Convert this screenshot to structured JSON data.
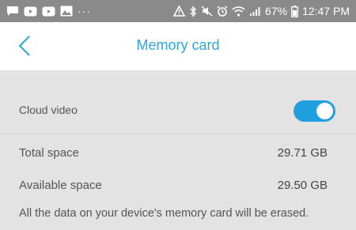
{
  "status_bar": {
    "battery": "67%",
    "time": "12:47 PM",
    "overflow": "···"
  },
  "header": {
    "title": "Memory card"
  },
  "settings": {
    "cloud_video_label": "Cloud video",
    "cloud_video_enabled": true,
    "total_space_label": "Total space",
    "total_space_value": "29.71 GB",
    "available_space_label": "Available space",
    "available_space_value": "29.50 GB",
    "warning_text": "All the data on your device's memory card will be erased."
  },
  "colors": {
    "accent": "#29a8e0",
    "toggle_on": "#1f9fe0",
    "status_bar": "#8a8a8a"
  }
}
